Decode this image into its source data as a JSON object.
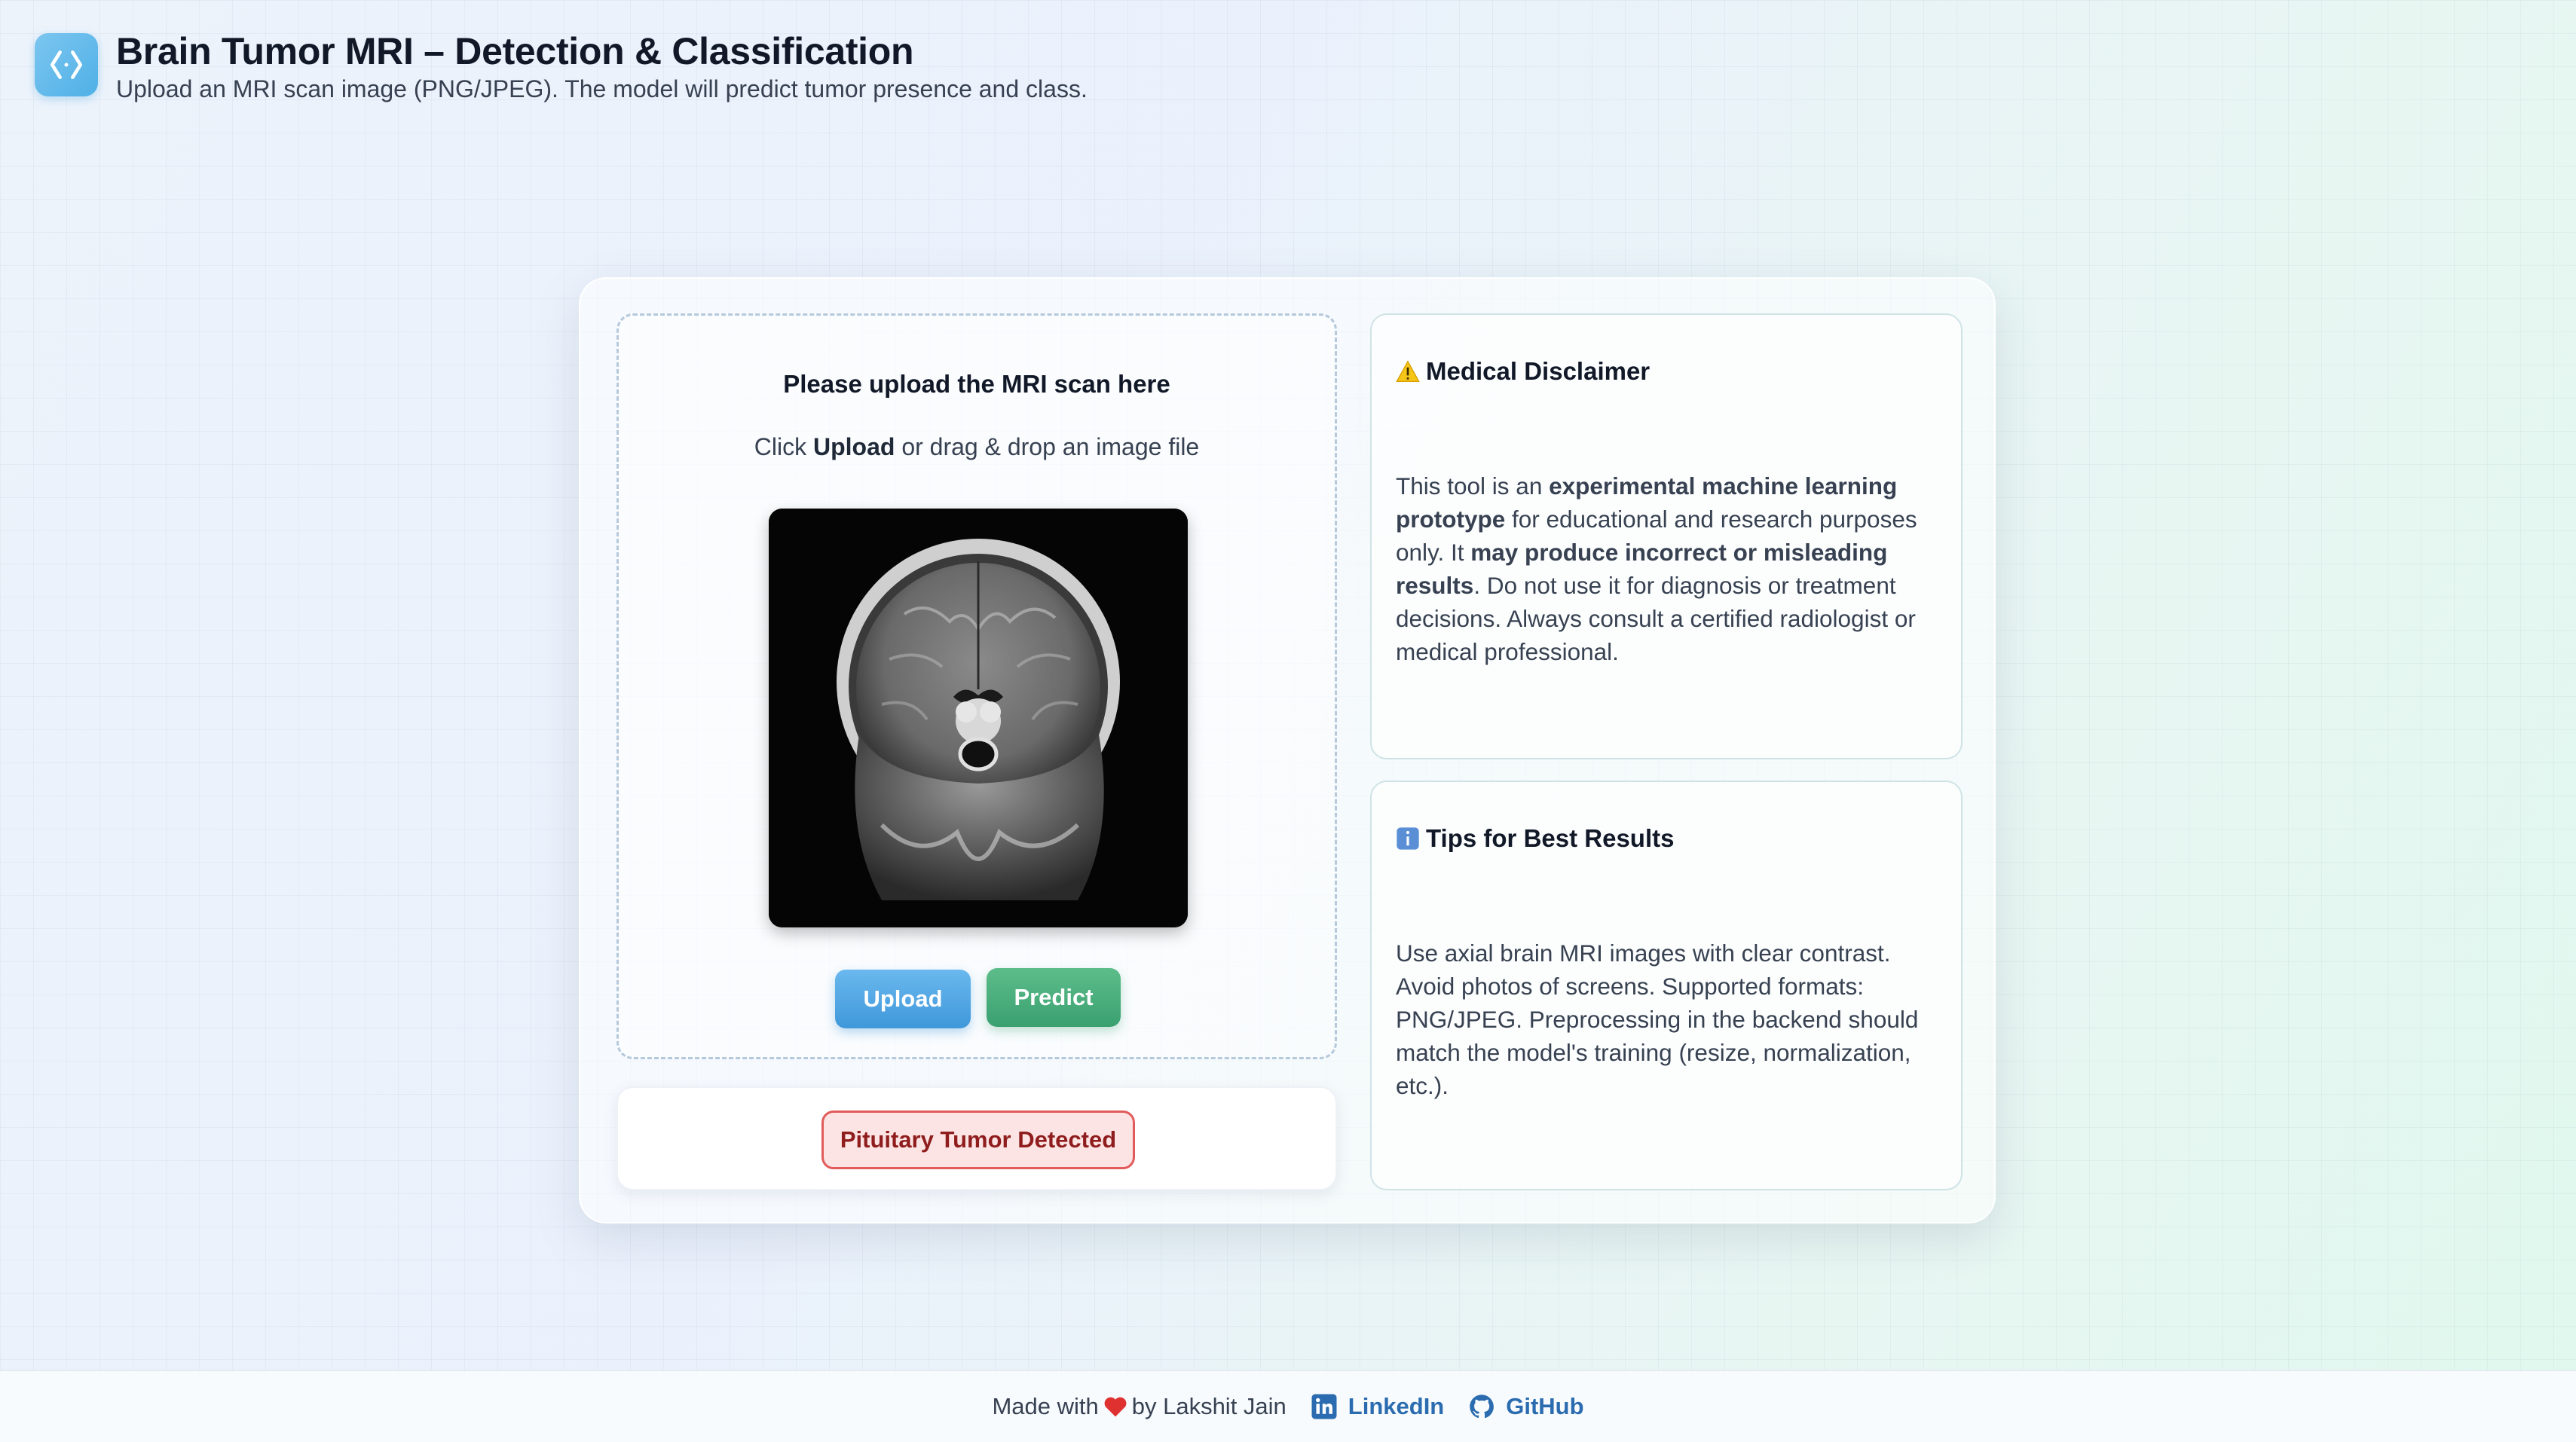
{
  "header": {
    "title": "Brain Tumor MRI – Detection & Classification",
    "subtitle": "Upload an MRI scan image (PNG/JPEG). The model will predict tumor presence and class.",
    "logo_icon": "code-brackets-icon"
  },
  "upload": {
    "title": "Please upload the MRI scan here",
    "hint_prefix": "Click ",
    "hint_bold": "Upload",
    "hint_suffix": " or drag & drop an image file",
    "preview_label": "MRI scan preview",
    "upload_button": "Upload",
    "predict_button": "Predict"
  },
  "result": {
    "label": "Pituitary Tumor Detected",
    "status_color": "#e25b5b"
  },
  "disclaimer": {
    "icon": "warning-icon",
    "title": "Medical Disclaimer",
    "p1": "This tool is an ",
    "b1": "experimental machine learning prototype",
    "p2": " for educational and research purposes only. It ",
    "b2": "may produce incorrect or misleading results",
    "p3": ". Do not use it for diagnosis or treatment decisions. Always consult a certified radiologist or medical professional."
  },
  "tips": {
    "icon": "info-icon",
    "title": "Tips for Best Results",
    "body": "Use axial brain MRI images with clear contrast. Avoid photos of screens. Supported formats: PNG/JPEG. Preprocessing in the backend should match the model's training (resize, normalization, etc.)."
  },
  "footer": {
    "made_with": "Made with",
    "by": "by Lakshit Jain",
    "linkedin": "LinkedIn",
    "github": "GitHub"
  },
  "colors": {
    "upload_button": "#4ea8e4",
    "predict_button": "#45ab7b",
    "link": "#2b6cb0"
  }
}
